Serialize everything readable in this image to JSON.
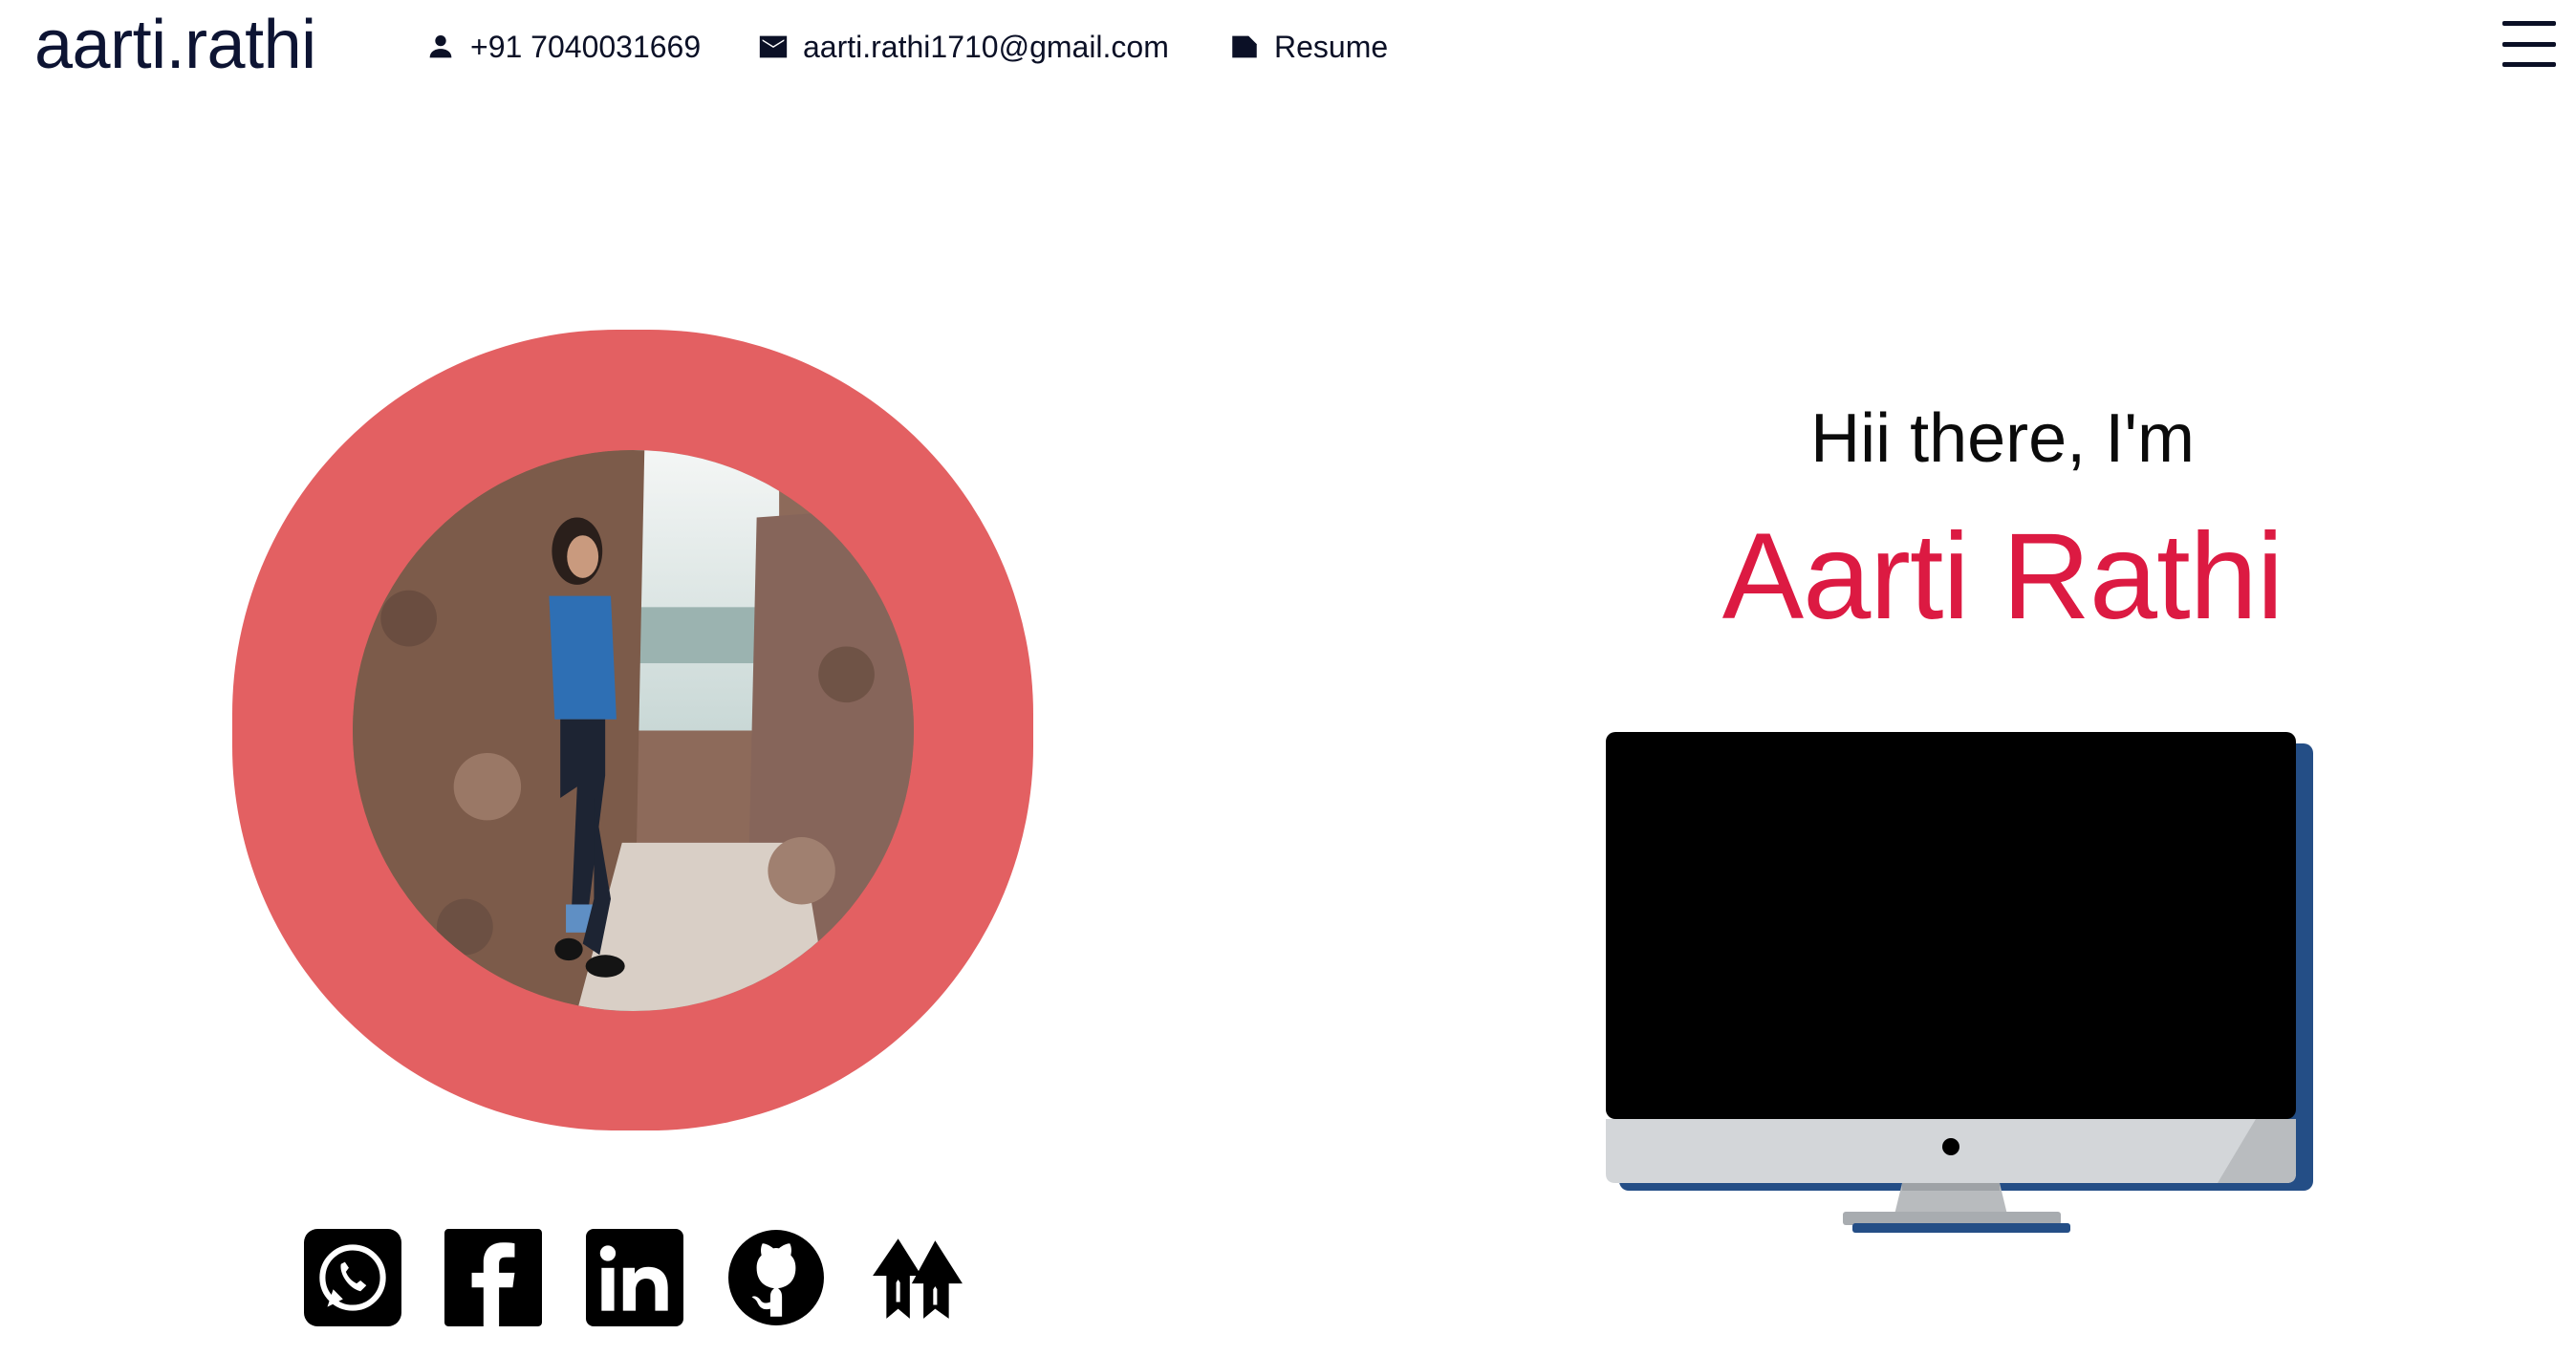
{
  "header": {
    "logo": "aarti.rathi",
    "phone": {
      "icon": "person-icon",
      "label": "+91 7040031669"
    },
    "email": {
      "icon": "mail-icon",
      "label": "aarti.rathi1710@gmail.com"
    },
    "resume": {
      "icon": "label-icon",
      "label": "Resume"
    },
    "menu_icon": "hamburger-menu-icon"
  },
  "hero": {
    "greeting": "Hii there, I'm",
    "name": "Aarti Rathi",
    "name_color": "#dc1a42",
    "ring_color": "#e36062"
  },
  "socials": [
    {
      "icon": "whatsapp-icon"
    },
    {
      "icon": "facebook-icon"
    },
    {
      "icon": "linkedin-icon"
    },
    {
      "icon": "github-icon"
    },
    {
      "icon": "double-arrow-logo-icon"
    }
  ]
}
